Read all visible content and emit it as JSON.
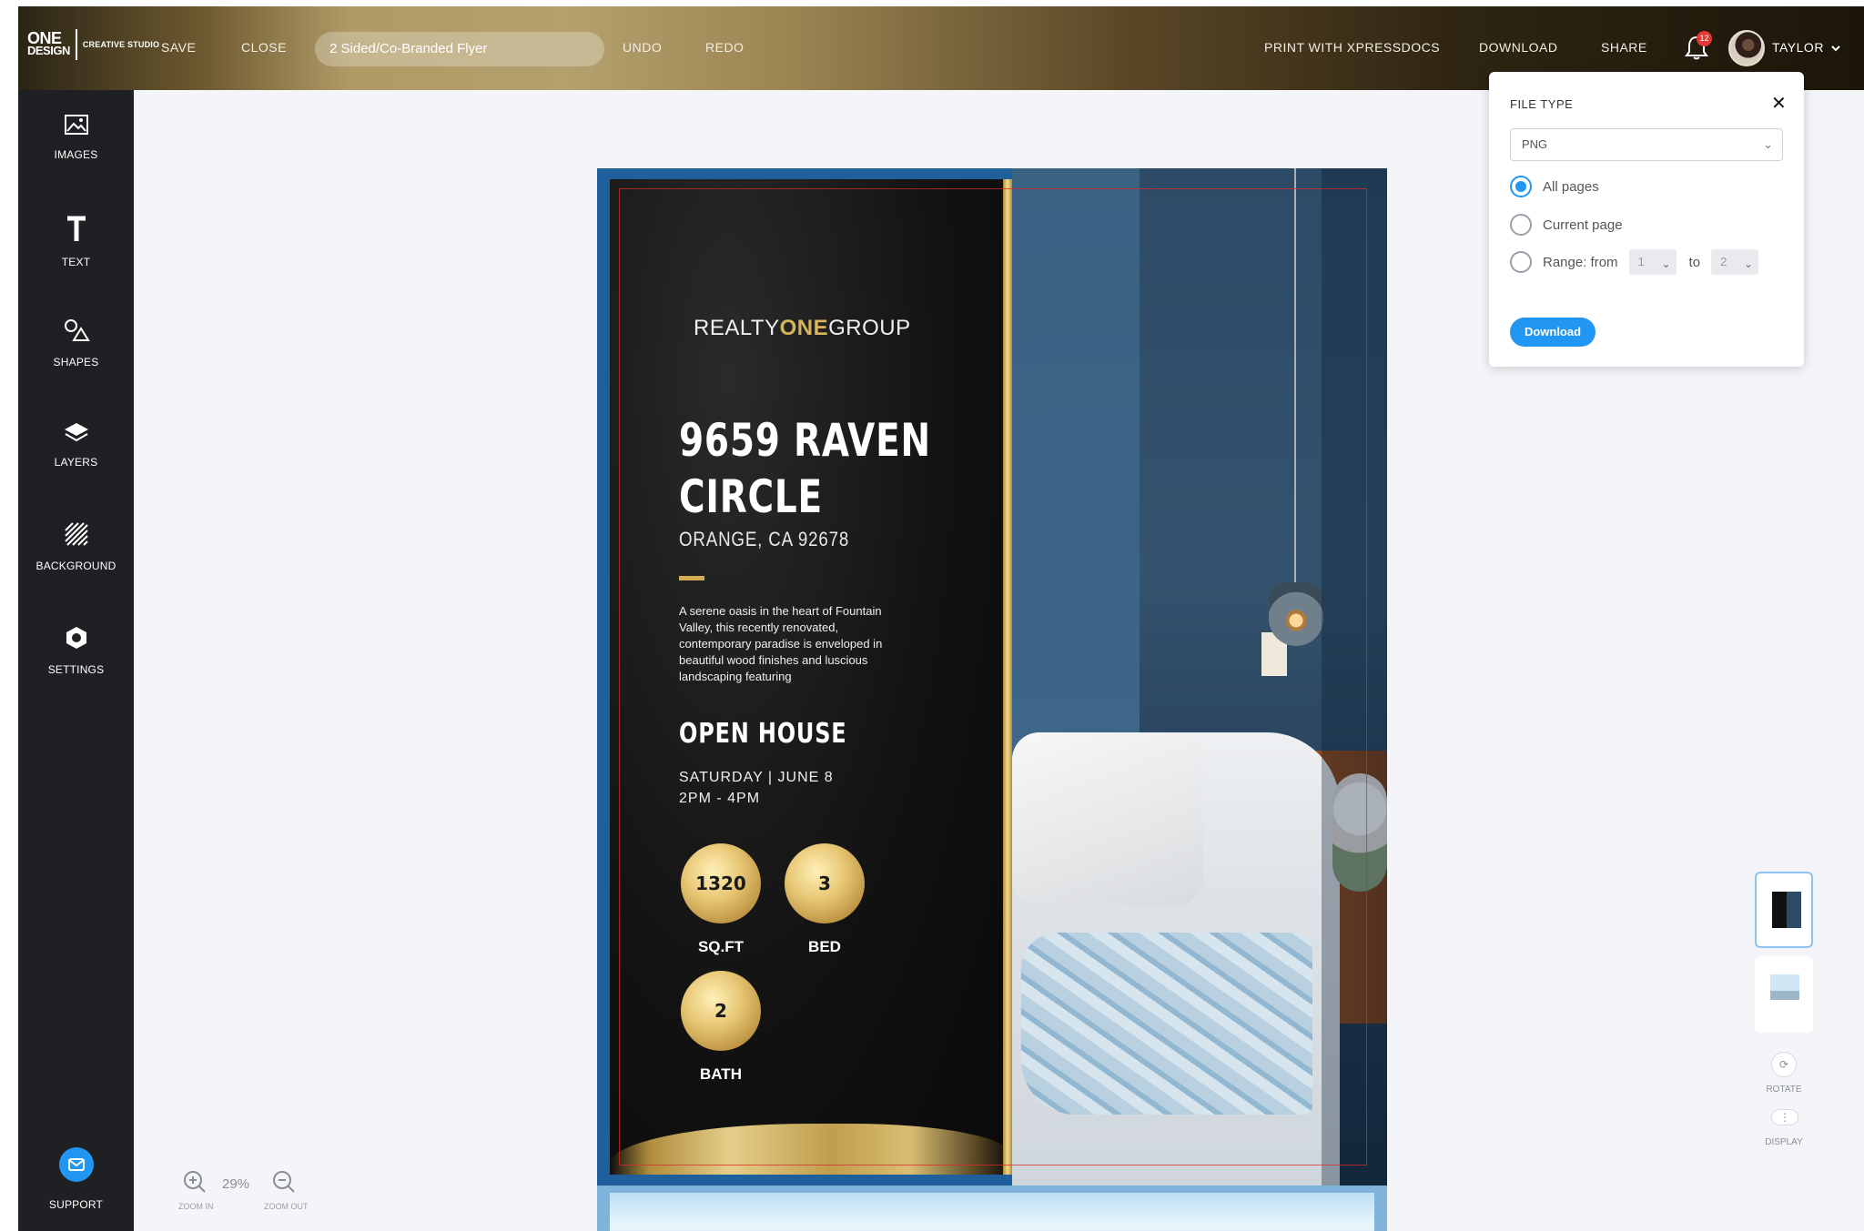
{
  "topbar": {
    "logo_line1": "ONE",
    "logo_line2": "DESIGN",
    "logo_sub": "CREATIVE STUDIO",
    "save_label": "SAVE",
    "close_label": "CLOSE",
    "document_title": "2 Sided/Co-Branded Flyer",
    "undo_label": "UNDO",
    "redo_label": "REDO",
    "print_label": "PRINT WITH XPRESSDOCS",
    "download_label": "DOWNLOAD",
    "share_label": "SHARE",
    "notification_count": "12",
    "user_name": "TAYLOR"
  },
  "sidebar": {
    "items": [
      {
        "label": "IMAGES",
        "icon": "image-icon"
      },
      {
        "label": "TEXT",
        "icon": "text-icon"
      },
      {
        "label": "SHAPES",
        "icon": "shapes-icon"
      },
      {
        "label": "LAYERS",
        "icon": "layers-icon"
      },
      {
        "label": "BACKGROUND",
        "icon": "background-icon"
      },
      {
        "label": "SETTINGS",
        "icon": "settings-icon"
      }
    ],
    "support_label": "SUPPORT"
  },
  "zoom": {
    "percent": "29%",
    "zoom_in_label": "ZOOM IN",
    "zoom_out_label": "ZOOM OUT"
  },
  "flyer": {
    "brand_part1": "REALTY",
    "brand_part2": "ONE",
    "brand_part3": "GROUP",
    "address_line1": "9659 RAVEN",
    "address_line2": "CIRCLE",
    "city_line": "ORANGE, CA 92678",
    "description": "A serene oasis in the heart of Fountain Valley, this recently renovated, contemporary paradise is enveloped in beautiful wood finishes and luscious landscaping featuring",
    "open_house_title": "OPEN HOUSE",
    "open_house_date": "SATURDAY | JUNE 8",
    "open_house_time": "2PM - 4PM",
    "stats": [
      {
        "value": "1320",
        "label": "SQ.FT"
      },
      {
        "value": "3",
        "label": "BED"
      },
      {
        "value": "2",
        "label": "BATH"
      }
    ]
  },
  "right_panel": {
    "rotate_label": "ROTATE",
    "display_label": "DISPLAY"
  },
  "download_popup": {
    "file_type_label": "FILE TYPE",
    "file_type_value": "PNG",
    "options": [
      "All pages",
      "Current page",
      "Range: from"
    ],
    "selected_option": "All pages",
    "range_from": "1",
    "range_to_label": "to",
    "range_to": "2",
    "download_button": "Download"
  },
  "colors": {
    "accent_blue": "#2196f3",
    "gold": "#d3ad55",
    "sidebar_bg": "#1f2023",
    "notification_red": "#e53935"
  }
}
